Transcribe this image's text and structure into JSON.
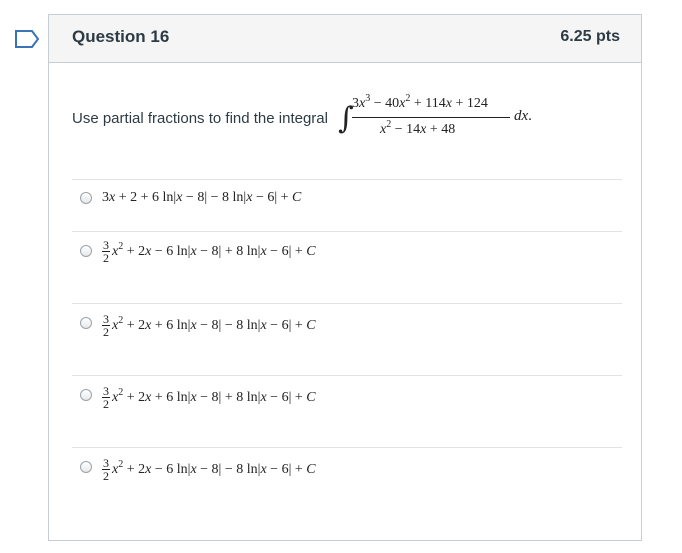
{
  "question": {
    "title": "Question 16",
    "points": "6.25 pts",
    "prompt": "Use partial fractions to find the integral",
    "integral": {
      "numerator_html": "3<i>x</i><sup>3</sup> − 40<i>x</i><sup>2</sup> + 114<i>x</i> + 124",
      "denominator_html": "<i>x</i><sup>2</sup> − 14<i>x</i> + 48",
      "differential": "dx",
      "end": "."
    }
  },
  "answers": [
    {
      "text_html": "3<i>x</i> + 2 + 6 ln|<i>x</i> − 8| − 8 ln|<i>x</i> − 6| + <i>C</i>"
    },
    {
      "coef_num": "3",
      "coef_den": "2",
      "text_html": "<i>x</i><sup>2</sup> + 2<i>x</i> − 6 ln|<i>x</i> − 8| + 8 ln|<i>x</i> − 6| + <i>C</i>"
    },
    {
      "coef_num": "3",
      "coef_den": "2",
      "text_html": "<i>x</i><sup>2</sup> + 2<i>x</i> + 6 ln|<i>x</i> − 8| − 8 ln|<i>x</i> − 6| + <i>C</i>"
    },
    {
      "coef_num": "3",
      "coef_den": "2",
      "text_html": "<i>x</i><sup>2</sup> + 2<i>x</i> + 6 ln|<i>x</i> − 8| + 8 ln|<i>x</i> − 6| + <i>C</i>"
    },
    {
      "coef_num": "3",
      "coef_den": "2",
      "text_html": "<i>x</i><sup>2</sup> + 2<i>x</i> − 6 ln|<i>x</i> − 8| − 8 ln|<i>x</i> − 6| + <i>C</i>"
    }
  ]
}
